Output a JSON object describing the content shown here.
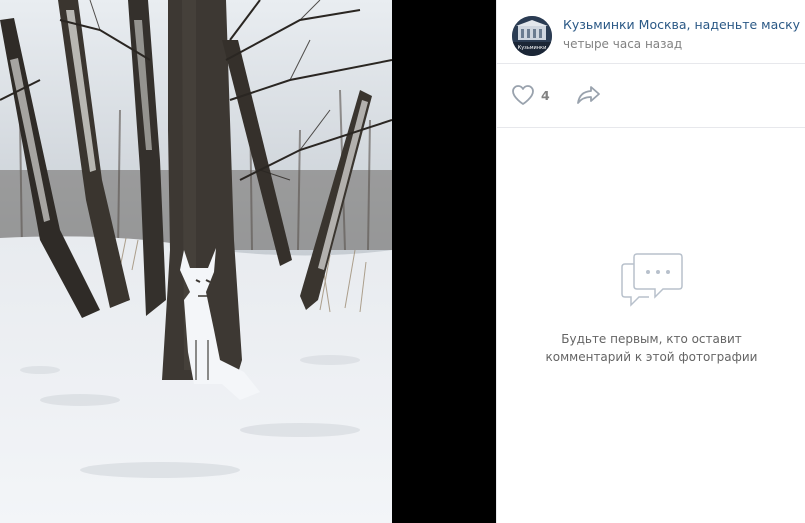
{
  "post": {
    "author_name": "Кузьминки Москва, наденьте маску",
    "time": "четыре часа назад",
    "avatar_text": "Кузьминки"
  },
  "actions": {
    "like_count": "4"
  },
  "comments": {
    "empty_text": "Будьте первым, кто оставит\nкомментарий к этой фотографии"
  },
  "colors": {
    "link": "#2a5885",
    "muted": "#828282",
    "divider": "#e7e8ec",
    "icon": "#a7b1bd",
    "backdrop": "#000000"
  },
  "icons": [
    "heart-icon",
    "share-arrow-icon",
    "comment-bubble-icon"
  ]
}
